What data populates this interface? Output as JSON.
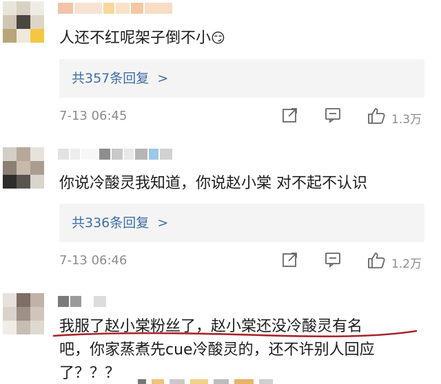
{
  "comments": [
    {
      "text_lines": [
        "人还不红呢架子倒不小"
      ],
      "emoji": "😏",
      "reply_label": "共357条回复",
      "reply_arrow": ">",
      "time": "7-13 06:45",
      "likes": "1.3万"
    },
    {
      "text_lines": [
        "你说冷酸灵我知道，你说赵小棠 对不起不认识"
      ],
      "reply_label": "共336条回复",
      "reply_arrow": ">",
      "time": "7-13 06:46",
      "likes": "1.2万"
    },
    {
      "text_lines": [
        "我服了赵小棠粉丝了，赵小棠还没冷酸灵有名",
        "吧，你家蒸煮先cue冷酸灵的，还不许别人回应",
        "了？？？"
      ]
    }
  ],
  "icons": {
    "share": "share-icon",
    "comment": "comment-icon",
    "like": "thumbs-up-icon",
    "reply_arrow": "chevron-right-icon"
  },
  "colors": {
    "reply_link": "#3d6ea8",
    "meta_text": "#8c8c8c",
    "underline": "#a8232b"
  }
}
